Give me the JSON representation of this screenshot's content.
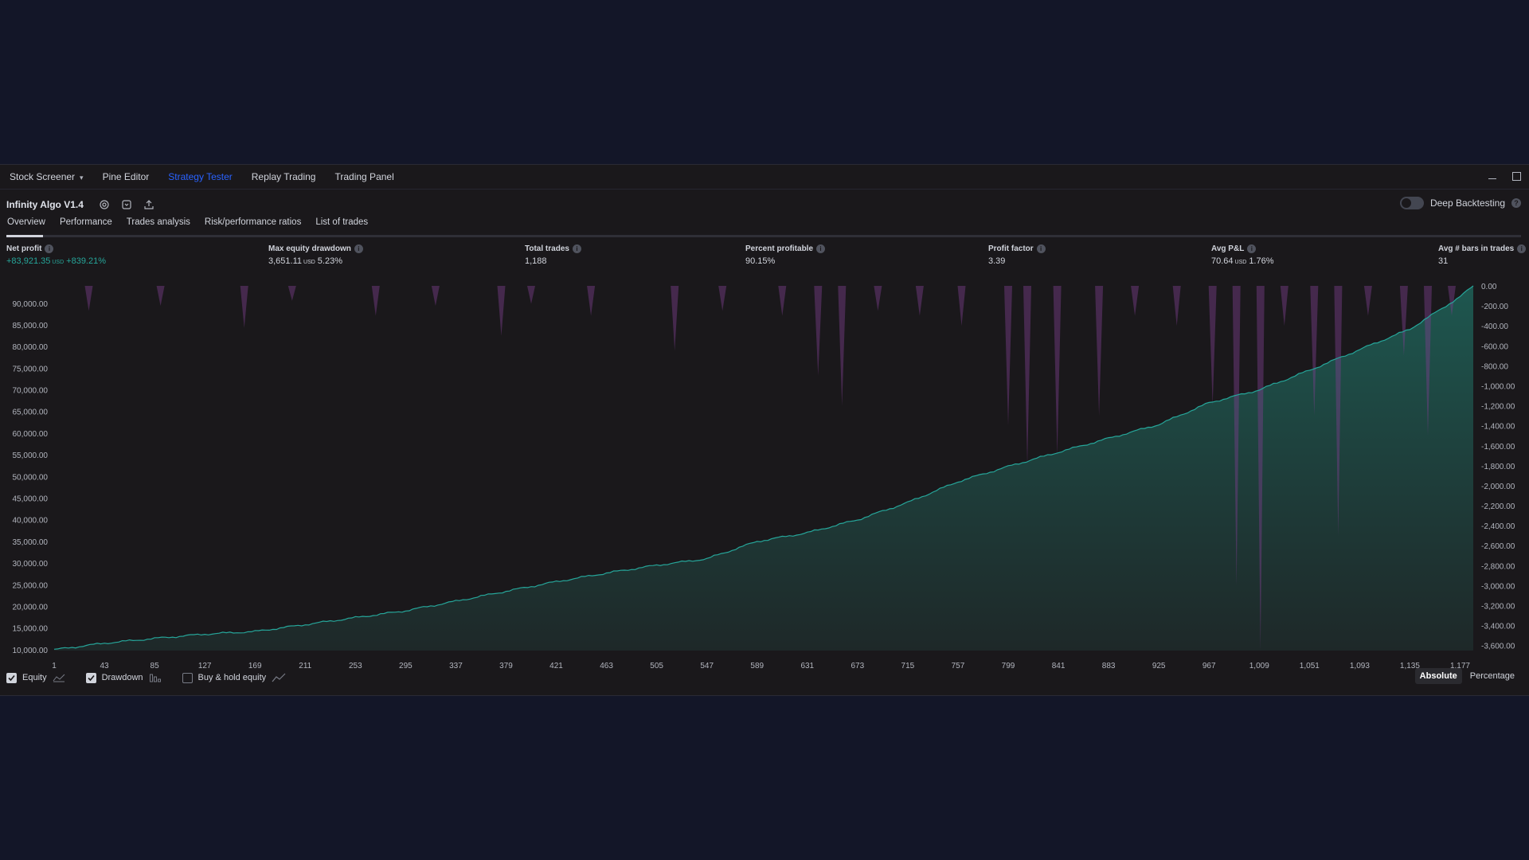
{
  "topbar": {
    "tabs": [
      {
        "label": "Stock Screener",
        "dropdown": true
      },
      {
        "label": "Pine Editor"
      },
      {
        "label": "Strategy Tester",
        "active": true
      },
      {
        "label": "Replay Trading"
      },
      {
        "label": "Trading Panel"
      }
    ]
  },
  "strategy": {
    "name": "Infinity Algo V1.4",
    "deep_backtesting_label": "Deep Backtesting",
    "deep_backtesting_enabled": false
  },
  "subtabs": [
    "Overview",
    "Performance",
    "Trades analysis",
    "Risk/performance ratios",
    "List of trades"
  ],
  "active_subtab": "Overview",
  "stats": {
    "net_profit": {
      "label": "Net profit",
      "value": "+83,921.35",
      "unit": "USD",
      "pct": "+839.21%"
    },
    "max_drawdown": {
      "label": "Max equity drawdown",
      "value": "3,651.11",
      "unit": "USD",
      "pct": "5.23%"
    },
    "total_trades": {
      "label": "Total trades",
      "value": "1,188"
    },
    "percent_profitable": {
      "label": "Percent profitable",
      "value": "90.15%"
    },
    "profit_factor": {
      "label": "Profit factor",
      "value": "3.39"
    },
    "avg_pnl": {
      "label": "Avg P&L",
      "value": "70.64",
      "unit": "USD",
      "pct": "1.76%"
    },
    "avg_bars": {
      "label": "Avg # bars in trades",
      "value": "31"
    }
  },
  "chart_data": {
    "type": "area",
    "title": "",
    "xlabel": "",
    "ylabel": "",
    "x_ticks": [
      "1",
      "43",
      "85",
      "127",
      "169",
      "211",
      "253",
      "295",
      "337",
      "379",
      "421",
      "463",
      "505",
      "547",
      "589",
      "631",
      "673",
      "715",
      "757",
      "799",
      "841",
      "883",
      "925",
      "967",
      "1,009",
      "1,051",
      "1,093",
      "1,135",
      "1,177"
    ],
    "x_range": [
      1,
      1188
    ],
    "y_left_ticks": [
      "90,000.00",
      "85,000.00",
      "80,000.00",
      "75,000.00",
      "70,000.00",
      "65,000.00",
      "60,000.00",
      "55,000.00",
      "50,000.00",
      "45,000.00",
      "40,000.00",
      "35,000.00",
      "30,000.00",
      "25,000.00",
      "20,000.00",
      "15,000.00",
      "10,000.00"
    ],
    "y_left_range": [
      9800,
      94000
    ],
    "y_right_ticks": [
      "0.00",
      "-200.00",
      "-400.00",
      "-600.00",
      "-800.00",
      "-1,000.00",
      "-1,200.00",
      "-1,400.00",
      "-1,600.00",
      "-1,800.00",
      "-2,000.00",
      "-2,200.00",
      "-2,400.00",
      "-2,600.00",
      "-2,800.00",
      "-3,000.00",
      "-3,200.00",
      "-3,400.00",
      "-3,600.00"
    ],
    "y_right_range": [
      -3650,
      0
    ],
    "series": [
      {
        "name": "Equity",
        "color": "#26a69a",
        "x": [
          1,
          43,
          85,
          127,
          169,
          211,
          253,
          295,
          337,
          379,
          421,
          463,
          505,
          547,
          589,
          631,
          673,
          715,
          757,
          799,
          841,
          883,
          925,
          967,
          1009,
          1051,
          1093,
          1135,
          1177,
          1188
        ],
        "values": [
          10000,
          11500,
          12600,
          13600,
          14200,
          15800,
          17400,
          19000,
          21200,
          23500,
          25700,
          27700,
          29500,
          31000,
          35000,
          37000,
          40000,
          44000,
          48800,
          52300,
          55600,
          58800,
          62000,
          67000,
          70000,
          74500,
          79300,
          84000,
          91500,
          94000
        ]
      },
      {
        "name": "Drawdown",
        "color": "#7b3f8c",
        "x": [
          30,
          90,
          160,
          200,
          270,
          320,
          375,
          400,
          450,
          520,
          560,
          610,
          640,
          660,
          690,
          725,
          760,
          799,
          815,
          840,
          875,
          905,
          940,
          970,
          990,
          1010,
          1030,
          1055,
          1075,
          1100,
          1130,
          1150,
          1170
        ],
        "values": [
          -250,
          -200,
          -420,
          -150,
          -300,
          -200,
          -500,
          -180,
          -300,
          -650,
          -250,
          -300,
          -900,
          -1200,
          -250,
          -300,
          -400,
          -1400,
          -1800,
          -1700,
          -1300,
          -300,
          -400,
          -1200,
          -3000,
          -3650,
          -400,
          -1300,
          -2500,
          -300,
          -700,
          -1500,
          -300
        ]
      }
    ],
    "grid": false,
    "legend": [
      {
        "label": "Equity",
        "checked": true
      },
      {
        "label": "Drawdown",
        "checked": true
      },
      {
        "label": "Buy & hold equity",
        "checked": false
      }
    ]
  },
  "modes": {
    "absolute": "Absolute",
    "percentage": "Percentage",
    "active": "Absolute"
  }
}
